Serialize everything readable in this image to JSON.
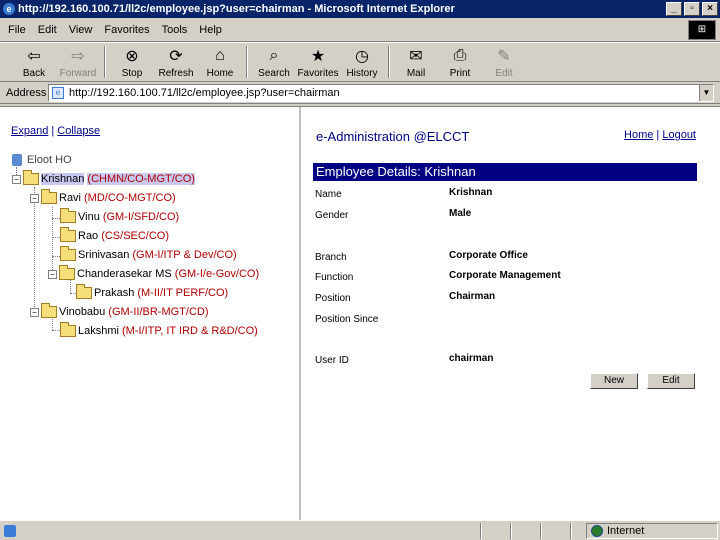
{
  "window": {
    "title": "http://192.160.100.71/ll2c/employee.jsp?user=chairman - Microsoft Internet Explorer",
    "icon": "ie-icon",
    "controls": [
      "_",
      "▫",
      "×"
    ]
  },
  "menu": [
    {
      "label": "File"
    },
    {
      "label": "Edit"
    },
    {
      "label": "View"
    },
    {
      "label": "Favorites"
    },
    {
      "label": "Tools"
    },
    {
      "label": "Help"
    }
  ],
  "toolbar": [
    {
      "label": "Back",
      "icon": "back-arrow-icon",
      "glyph": "⇦",
      "disabled": false
    },
    {
      "label": "Forward",
      "icon": "forward-arrow-icon",
      "glyph": "⇨",
      "disabled": true
    },
    {
      "label": "Stop",
      "icon": "stop-icon",
      "glyph": "⊗",
      "disabled": false
    },
    {
      "label": "Refresh",
      "icon": "refresh-icon",
      "glyph": "⟳",
      "disabled": false
    },
    {
      "label": "Home",
      "icon": "home-icon",
      "glyph": "⌂",
      "disabled": false
    },
    {
      "label": "Search",
      "icon": "search-icon",
      "glyph": "⌕",
      "disabled": false
    },
    {
      "label": "Favorites",
      "icon": "favorites-icon",
      "glyph": "★",
      "disabled": false
    },
    {
      "label": "History",
      "icon": "history-icon",
      "glyph": "◷",
      "disabled": false
    },
    {
      "label": "Mail",
      "icon": "mail-icon",
      "glyph": "✉",
      "disabled": false
    },
    {
      "label": "Print",
      "icon": "print-icon",
      "glyph": "⎙",
      "disabled": false
    },
    {
      "label": "Edit",
      "icon": "edit-icon",
      "glyph": "✎",
      "disabled": true
    }
  ],
  "address": {
    "label": "Address",
    "url": "http://192.160.100.71/ll2c/employee.jsp?user=chairman"
  },
  "left": {
    "expand_label": "Expand",
    "separator": "|",
    "collapse_label": "Collapse",
    "root_label": "Eloot HO",
    "tree": [
      {
        "name": "Krishnan",
        "desig": "(CHMN/CO-MGT/CO)",
        "selected": true
      },
      {
        "name": "Ravi",
        "desig": "(MD/CO-MGT/CO)"
      },
      {
        "name": "Vinu",
        "desig": "(GM-I/SFD/CO)"
      },
      {
        "name": "Rao",
        "desig": "(CS/SEC/CO)"
      },
      {
        "name": "Srinivasan",
        "desig": "(GM-I/ITP & Dev/CO)"
      },
      {
        "name": "Chanderasekar MS",
        "desig": "(GM-I/e-Gov/CO)"
      },
      {
        "name": "Prakash",
        "desig": "(M-II/IT PERF/CO)"
      },
      {
        "name": "Vinobabu",
        "desig": "(GM-II/BR-MGT/CD)"
      },
      {
        "name": "Lakshmi",
        "desig": "(M-I/ITP, IT IRD & R&D/CO)"
      }
    ]
  },
  "right": {
    "app_title": "e-Administration",
    "org": "@ELCCT",
    "home_link": "Home",
    "link_separator": "|",
    "logout_link": "Logout",
    "details_header": "Employee Details: Krishnan",
    "fields": [
      {
        "label": "Name",
        "value": "Krishnan"
      },
      {
        "label": "Gender",
        "value": "Male"
      },
      {
        "label": "Branch",
        "value": "Corporate Office"
      },
      {
        "label": "Function",
        "value": "Corporate Management"
      },
      {
        "label": "Position",
        "value": "Chairman"
      },
      {
        "label": "Position Since",
        "value": ""
      },
      {
        "label": "User ID",
        "value": "chairman"
      }
    ],
    "new_button": "New",
    "edit_button": "Edit"
  },
  "status": {
    "zone": "Internet"
  }
}
